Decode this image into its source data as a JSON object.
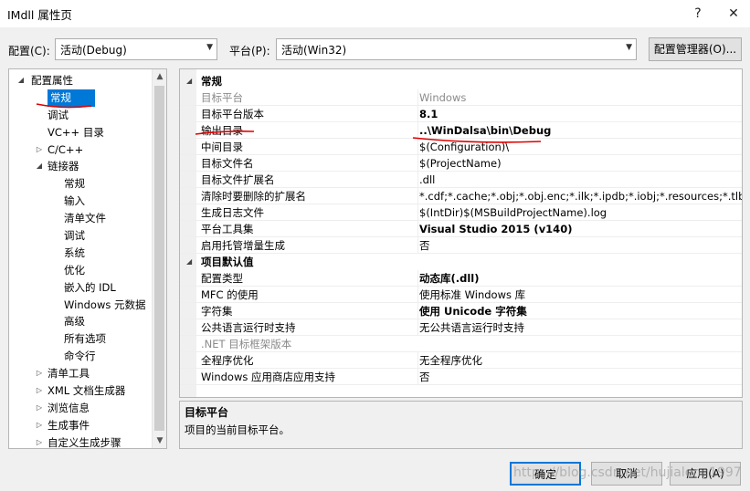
{
  "window": {
    "title": "IMdll 属性页",
    "help_button": "?",
    "close_button": "✕"
  },
  "toolbar": {
    "config_label": "配置(C):",
    "config_value": "活动(Debug)",
    "platform_label": "平台(P):",
    "platform_value": "活动(Win32)",
    "config_manager_button": "配置管理器(O)..."
  },
  "tree": {
    "items": [
      {
        "label": "配置属性",
        "level": 0,
        "expander": "◢",
        "selected": false
      },
      {
        "label": "常规",
        "level": 1,
        "expander": "",
        "selected": true
      },
      {
        "label": "调试",
        "level": 1,
        "expander": "",
        "selected": false
      },
      {
        "label": "VC++ 目录",
        "level": 1,
        "expander": "",
        "selected": false
      },
      {
        "label": "C/C++",
        "level": 1,
        "expander": "▷",
        "selected": false
      },
      {
        "label": "链接器",
        "level": 1,
        "expander": "◢",
        "selected": false
      },
      {
        "label": "常规",
        "level": 2,
        "expander": "",
        "selected": false
      },
      {
        "label": "输入",
        "level": 2,
        "expander": "",
        "selected": false
      },
      {
        "label": "清单文件",
        "level": 2,
        "expander": "",
        "selected": false
      },
      {
        "label": "调试",
        "level": 2,
        "expander": "",
        "selected": false
      },
      {
        "label": "系统",
        "level": 2,
        "expander": "",
        "selected": false
      },
      {
        "label": "优化",
        "level": 2,
        "expander": "",
        "selected": false
      },
      {
        "label": "嵌入的 IDL",
        "level": 2,
        "expander": "",
        "selected": false
      },
      {
        "label": "Windows 元数据",
        "level": 2,
        "expander": "",
        "selected": false
      },
      {
        "label": "高级",
        "level": 2,
        "expander": "",
        "selected": false
      },
      {
        "label": "所有选项",
        "level": 2,
        "expander": "",
        "selected": false
      },
      {
        "label": "命令行",
        "level": 2,
        "expander": "",
        "selected": false
      },
      {
        "label": "清单工具",
        "level": 1,
        "expander": "▷",
        "selected": false
      },
      {
        "label": "XML 文档生成器",
        "level": 1,
        "expander": "▷",
        "selected": false
      },
      {
        "label": "浏览信息",
        "level": 1,
        "expander": "▷",
        "selected": false
      },
      {
        "label": "生成事件",
        "level": 1,
        "expander": "▷",
        "selected": false
      },
      {
        "label": "自定义生成步骤",
        "level": 1,
        "expander": "▷",
        "selected": false
      }
    ]
  },
  "grid": {
    "rows": [
      {
        "type": "category",
        "name": "常规",
        "expander": "◢"
      },
      {
        "type": "prop",
        "name": "目标平台",
        "value": "Windows",
        "name_style": "gray",
        "value_style": "gray"
      },
      {
        "type": "prop",
        "name": "目标平台版本",
        "value": "8.1",
        "name_style": "",
        "value_style": "b"
      },
      {
        "type": "prop",
        "name": "输出目录",
        "value": "..\\WinDalsa\\bin\\Debug",
        "name_style": "",
        "value_style": "b"
      },
      {
        "type": "prop",
        "name": "中间目录",
        "value": "$(Configuration)\\",
        "name_style": "",
        "value_style": ""
      },
      {
        "type": "prop",
        "name": "目标文件名",
        "value": "$(ProjectName)",
        "name_style": "",
        "value_style": ""
      },
      {
        "type": "prop",
        "name": "目标文件扩展名",
        "value": ".dll",
        "name_style": "",
        "value_style": ""
      },
      {
        "type": "prop",
        "name": "清除时要删除的扩展名",
        "value": "*.cdf;*.cache;*.obj;*.obj.enc;*.ilk;*.ipdb;*.iobj;*.resources;*.tlb;*.tli;*.t",
        "name_style": "",
        "value_style": ""
      },
      {
        "type": "prop",
        "name": "生成日志文件",
        "value": "$(IntDir)$(MSBuildProjectName).log",
        "name_style": "",
        "value_style": ""
      },
      {
        "type": "prop",
        "name": "平台工具集",
        "value": "Visual Studio 2015 (v140)",
        "name_style": "",
        "value_style": "b"
      },
      {
        "type": "prop",
        "name": "启用托管增量生成",
        "value": "否",
        "name_style": "",
        "value_style": ""
      },
      {
        "type": "category",
        "name": "项目默认值",
        "expander": "◢"
      },
      {
        "type": "prop",
        "name": "配置类型",
        "value": "动态库(.dll)",
        "name_style": "",
        "value_style": "b"
      },
      {
        "type": "prop",
        "name": "MFC 的使用",
        "value": "使用标准 Windows 库",
        "name_style": "",
        "value_style": ""
      },
      {
        "type": "prop",
        "name": "字符集",
        "value": "使用 Unicode 字符集",
        "name_style": "",
        "value_style": "b"
      },
      {
        "type": "prop",
        "name": "公共语言运行时支持",
        "value": "无公共语言运行时支持",
        "name_style": "",
        "value_style": ""
      },
      {
        "type": "prop",
        "name": ".NET 目标框架版本",
        "value": "",
        "name_style": "gray",
        "value_style": ""
      },
      {
        "type": "prop",
        "name": "全程序优化",
        "value": "无全程序优化",
        "name_style": "",
        "value_style": ""
      },
      {
        "type": "prop",
        "name": "Windows 应用商店应用支持",
        "value": "否",
        "name_style": "",
        "value_style": ""
      }
    ]
  },
  "description": {
    "title": "目标平台",
    "text": "项目的当前目标平台。"
  },
  "buttons": {
    "ok": "确定",
    "cancel": "取消",
    "apply": "应用(A)"
  },
  "watermark": "https://blog.csdn.net/hujialong1997",
  "colors": {
    "selection": "#0078d7",
    "annotation": "#e00000"
  }
}
